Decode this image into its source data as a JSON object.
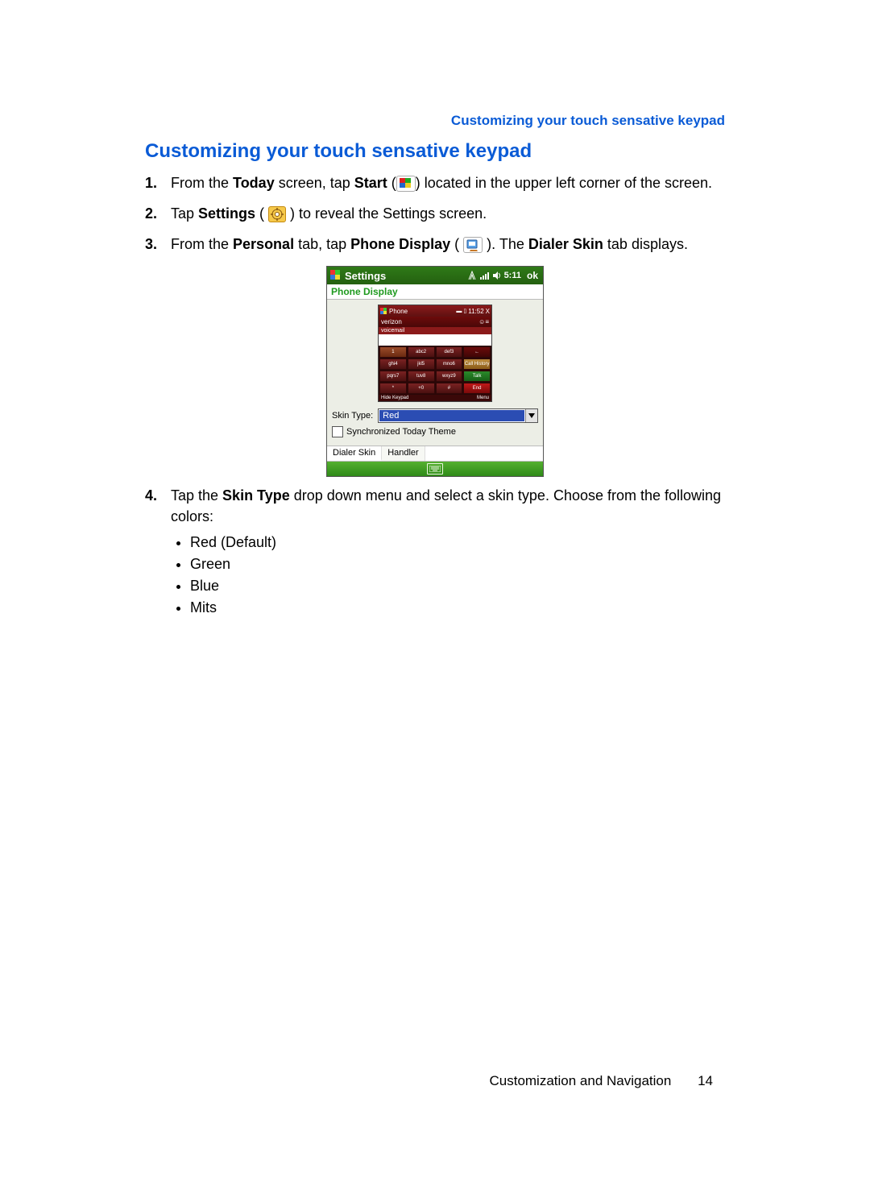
{
  "header_right": "Customizing your touch sensative keypad",
  "section_title": "Customizing your touch sensative keypad",
  "steps": {
    "s1": {
      "p1": "From the ",
      "b1": "Today",
      "p2": " screen, tap ",
      "b2": "Start",
      "p3": " (",
      "p4": ") located in the upper left corner of the screen."
    },
    "s2": {
      "p1": "Tap ",
      "b1": "Settings",
      "p2": " ( ",
      "p3": " ) to reveal the Settings screen."
    },
    "s3": {
      "p1": "From the ",
      "b1": "Personal",
      "p2": " tab, tap ",
      "b2": "Phone Display",
      "p3": " ( ",
      "p4": " ). The ",
      "b3": "Dialer Skin",
      "p5": " tab displays."
    },
    "s4": {
      "p1": "Tap the ",
      "b1": "Skin Type",
      "p2": " drop down menu and select a skin type. Choose from the following colors:"
    }
  },
  "bullets": [
    "Red (Default)",
    "Green",
    "Blue",
    "Mits"
  ],
  "ppc": {
    "title": "Settings",
    "time": "5:11",
    "ok": "ok",
    "subtitle": "Phone Display",
    "preview": {
      "title": "Phone",
      "time": "11:52",
      "x": "X",
      "operator": "verizon",
      "voicemail_label": "voicemail",
      "keys": {
        "r1c1": "1",
        "r1c2": "abc2",
        "r1c3": "def3",
        "r1c4": "←",
        "r2c1": "ghi4",
        "r2c2": "jkl5",
        "r2c3": "mno6",
        "r2c4": "Call History",
        "r3c1": "pqrs7",
        "r3c2": "tuv8",
        "r3c3": "wxyz9",
        "r3c4": "Talk",
        "r4c1": "*",
        "r4c2": "+0",
        "r4c3": "#",
        "r4c4": "End"
      },
      "bottom_left": "Hide Keypad",
      "bottom_right": "Menu"
    },
    "skin_type_label": "Skin Type:",
    "skin_type_value": "Red",
    "sync_label": "Synchronized Today Theme",
    "tab1": "Dialer Skin",
    "tab2": "Handler"
  },
  "footer": {
    "section": "Customization and Navigation",
    "page": "14"
  }
}
